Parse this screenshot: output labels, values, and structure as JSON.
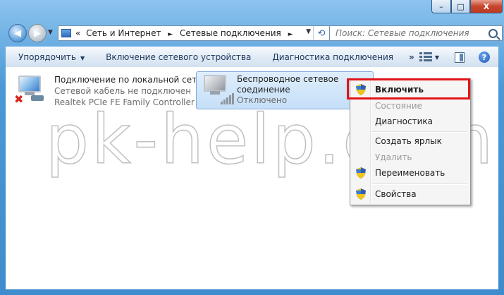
{
  "window": {
    "caption_buttons": {
      "minimize": "–",
      "maximize": "□",
      "close": "X"
    }
  },
  "address": {
    "prefix": "«",
    "crumbs": [
      "Сеть и Интернет",
      "Сетевые подключения"
    ],
    "separator": "►",
    "dropdown": "▼",
    "refresh": "⟲"
  },
  "search": {
    "placeholder": "Поиск: Сетевые подключения"
  },
  "toolbar": {
    "organize": "Упорядочить",
    "enable_device": "Включение сетевого устройства",
    "diagnostics": "Диагностика подключения",
    "more": "»",
    "help": "?"
  },
  "connections": [
    {
      "name": "Подключение по локальной сети",
      "status": "Сетевой кабель не подключен",
      "device": "Realtek PCIe FE Family Controller"
    },
    {
      "name_line1": "Беспроводное сетевое",
      "name_line2": "соединение",
      "status": "Отключено"
    }
  ],
  "watermark": "pk-help.com",
  "context_menu": {
    "items": [
      {
        "label": "Включить",
        "enabled": true,
        "bold": true,
        "icon": "shield-icon"
      },
      {
        "label": "Состояние",
        "enabled": false
      },
      {
        "label": "Диагностика",
        "enabled": true
      },
      {
        "label": "Создать ярлык",
        "enabled": true
      },
      {
        "label": "Удалить",
        "enabled": false
      },
      {
        "label": "Переименовать",
        "enabled": true,
        "icon": "shield-icon"
      },
      {
        "label": "Свойства",
        "enabled": true,
        "icon": "shield-icon"
      }
    ]
  },
  "colors": {
    "highlight": "#e1151b",
    "selection": "#c5dff8"
  }
}
